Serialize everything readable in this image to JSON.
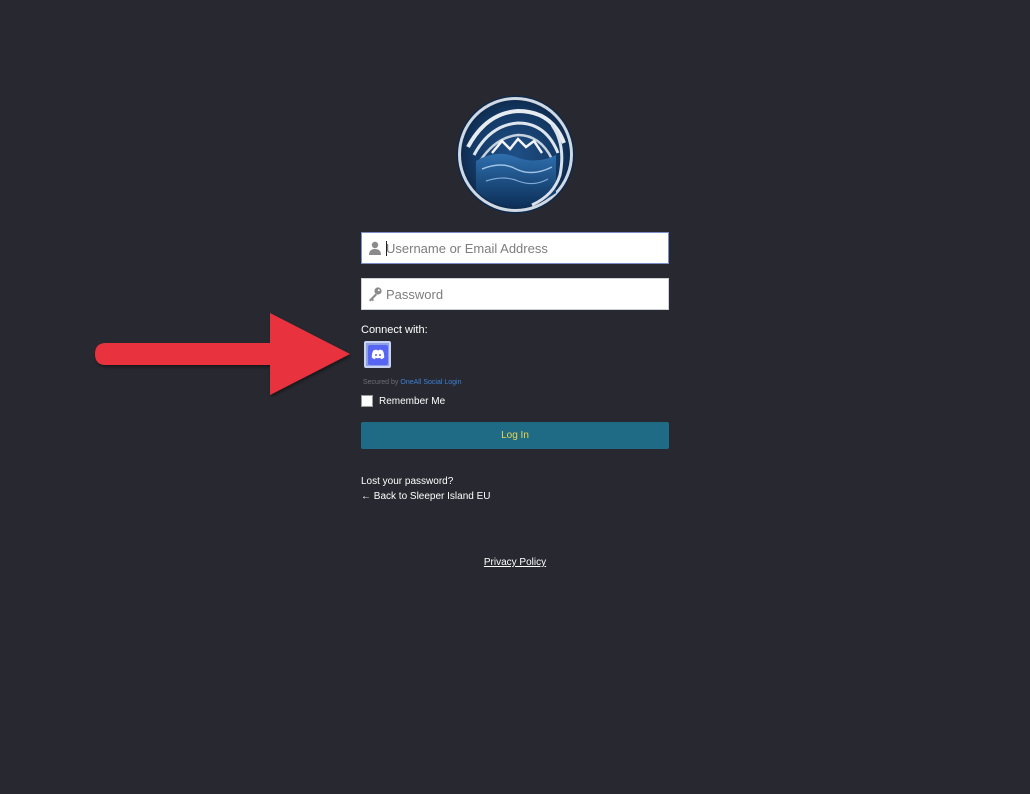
{
  "logo": {
    "icon": "site-logo-ocean-emblem"
  },
  "form": {
    "username": {
      "value": "",
      "placeholder": "Username or Email Address",
      "icon": "user-icon"
    },
    "password": {
      "value": "",
      "placeholder": "Password",
      "icon": "key-icon"
    },
    "connect_label": "Connect with:",
    "social": {
      "provider": "discord",
      "icon": "discord-icon",
      "color": "#5865f2"
    },
    "secured_prefix": "Secured by",
    "secured_link": "OneAll Social Login",
    "remember_label": "Remember Me",
    "remember_checked": false,
    "login_label": "Log In"
  },
  "links": {
    "lost_password": "Lost your password?",
    "back_to_site": "← Back to Sleeper Island EU",
    "privacy_policy": "Privacy Policy"
  },
  "annotation": {
    "icon": "red-arrow-pointer",
    "color": "#e8323d"
  },
  "colors": {
    "background": "#282830",
    "login_button": "#1f6b85",
    "login_text": "#f0d44a",
    "link_accent": "#3b82d6"
  }
}
